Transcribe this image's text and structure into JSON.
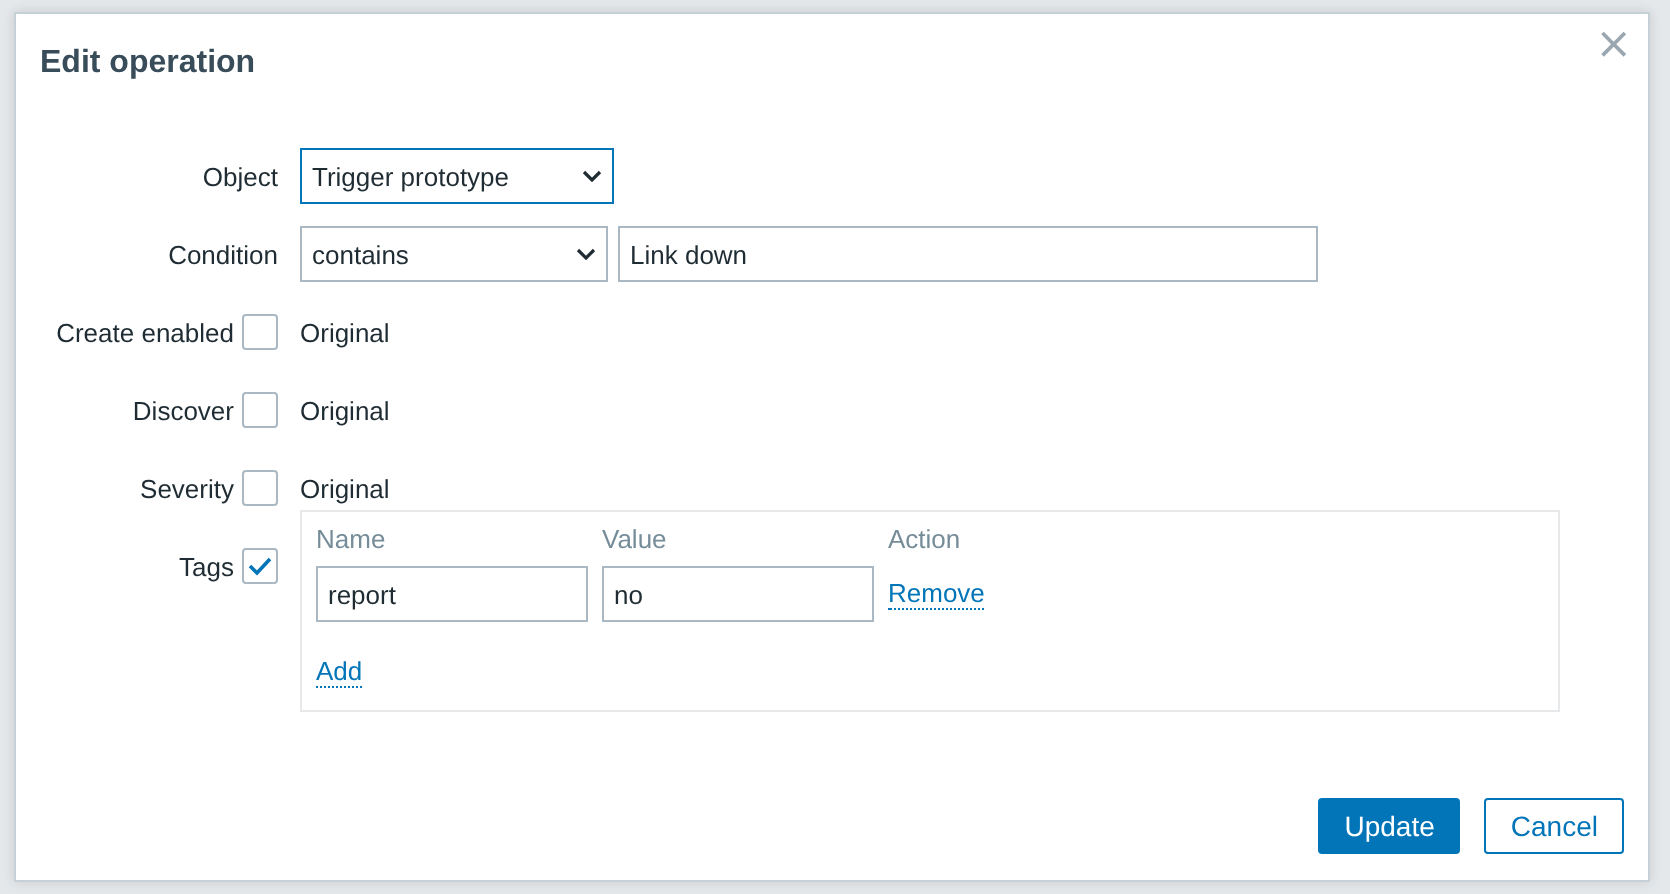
{
  "dialog": {
    "title": "Edit operation",
    "close": "×"
  },
  "fields": [
    {
      "kind": "select",
      "label": "Object",
      "value": "Trigger prototype",
      "focused": true
    },
    {
      "kind": "condition",
      "label": "Condition",
      "operator": "contains",
      "value": "Link down"
    },
    {
      "kind": "checkbox",
      "label": "Create enabled",
      "checked": false,
      "text": "Original"
    },
    {
      "kind": "checkbox",
      "label": "Discover",
      "checked": false,
      "text": "Original"
    },
    {
      "kind": "checkbox",
      "label": "Severity",
      "checked": false,
      "text": "Original"
    },
    {
      "kind": "tags",
      "label": "Tags",
      "checked": true,
      "columns": [
        "Name",
        "Value",
        "Action"
      ],
      "rows": [
        {
          "name": "report",
          "value": "no",
          "action": "Remove"
        }
      ],
      "add": "Add"
    }
  ],
  "buttons": [
    {
      "label": "Update",
      "primary": true
    },
    {
      "label": "Cancel",
      "primary": false
    }
  ]
}
